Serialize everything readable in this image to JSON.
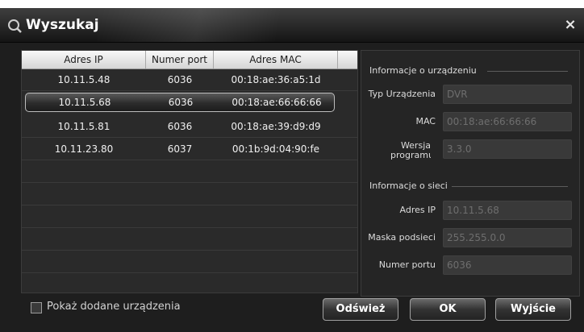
{
  "window": {
    "title": "Wyszukaj",
    "icon": "search-icon",
    "close_glyph": "×"
  },
  "device_list": {
    "headers": [
      "Adres IP",
      "Numer port",
      "Adres MAC"
    ],
    "rows": [
      {
        "ip": "10.11.5.48",
        "port": "6036",
        "mac": "00:18:ae:36:a5:1d"
      },
      {
        "ip": "10.11.5.68",
        "port": "6036",
        "mac": "00:18:ae:66:66:66"
      },
      {
        "ip": "10.11.5.81",
        "port": "6036",
        "mac": "00:18:ae:39:d9:d9"
      },
      {
        "ip": "10.11.23.80",
        "port": "6037",
        "mac": "00:1b:9d:04:90:fe"
      }
    ]
  },
  "device_info": {
    "section_title": "Informacje o urządzeniu",
    "type_label": "Typ Urządzenia",
    "type_value": "DVR",
    "mac_label": "MAC",
    "mac_value": "00:18:ae:66:66:66",
    "version_label": "Wersja programu",
    "version_value": "3.3.0"
  },
  "network_info": {
    "section_title": "Informacje o sieci",
    "ip_label": "Adres IP",
    "ip_value": "10.11.5.68",
    "mask_label": "Maska podsieci",
    "mask_value": "255.255.0.0",
    "port_label": "Numer portu",
    "port_value": "6036"
  },
  "footer": {
    "show_added_label": "Pokaż dodane urządzenia",
    "show_added_checked": false,
    "refresh_label": "Odśwież",
    "ok_label": "OK",
    "exit_label": "Wyjście"
  },
  "colors": {
    "background": "#1e1e1e",
    "header": "#e6e6e6",
    "value_text": "#6e6e6e"
  }
}
